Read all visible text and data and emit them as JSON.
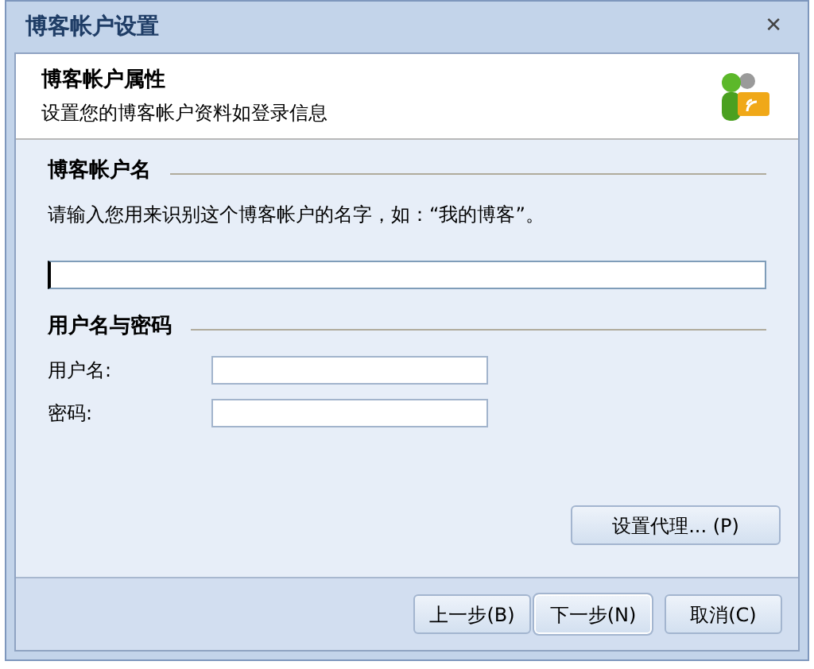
{
  "window": {
    "title": "博客帐户设置",
    "close": "✕"
  },
  "header": {
    "title": "博客帐户属性",
    "subtitle": "设置您的博客帐户资料如登录信息"
  },
  "account_name": {
    "heading": "博客帐户名",
    "hint": "请输入您用来识别这个博客帐户的名字，如：“我的博客”。",
    "focused": true
  },
  "credentials": {
    "heading": "用户名与密码",
    "fields": [
      {
        "label": "用户名:"
      },
      {
        "label": "密码:"
      }
    ]
  },
  "proxy_button": "设置代理... (P)",
  "buttons": [
    {
      "label": "上一步(B)",
      "focused": false
    },
    {
      "label": "下一步(N)",
      "focused": true
    },
    {
      "label": "取消(C)",
      "focused": false
    }
  ]
}
